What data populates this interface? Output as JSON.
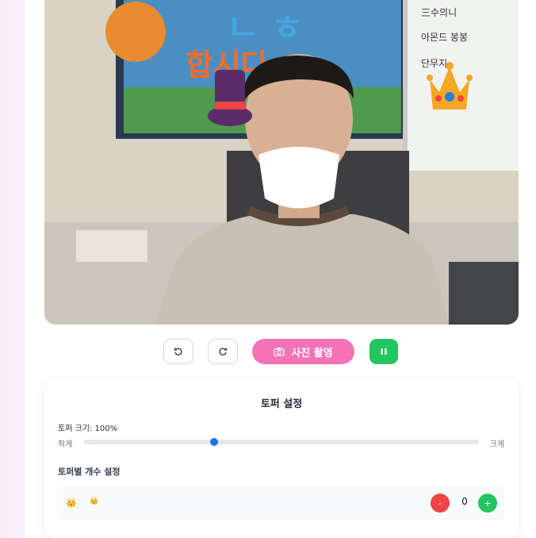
{
  "controls": {
    "capture_label": "사진 촬영",
    "pause_label": "⏸",
    "minus_label": "-",
    "plus_label": "+"
  },
  "settings": {
    "title": "토퍼 설정",
    "size_label": "토퍼 크기: 100%",
    "size_fraction": 0.33,
    "slider_min_label": "작게",
    "slider_max_label": "크게",
    "count_section_title": "토퍼별 개수 설정",
    "row": {
      "icon_a": "👑",
      "icon_b": "👑",
      "count": "0"
    }
  },
  "background_signs": {
    "board_items": [
      "三수의니",
      "아몬드 봉봉",
      "단무지"
    ],
    "poster_text": "합시다"
  },
  "colors": {
    "accent_pink": "#f472b6",
    "accent_green": "#22c55e",
    "accent_red": "#ef4444",
    "slider_blue": "#1a73e8"
  }
}
